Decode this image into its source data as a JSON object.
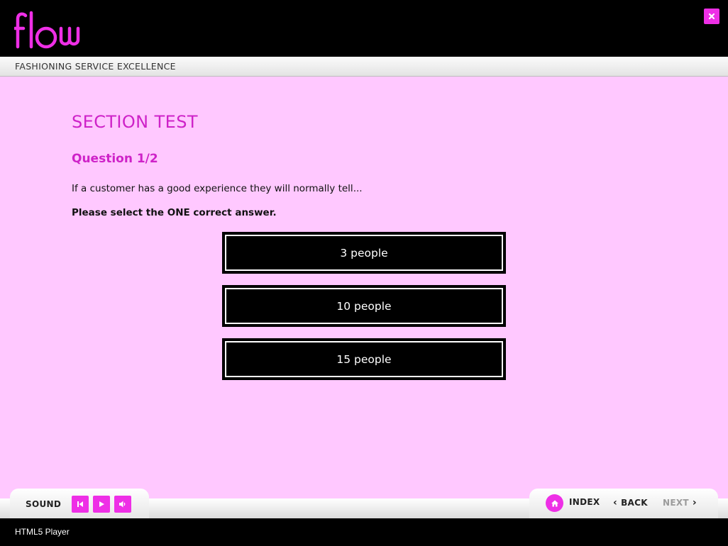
{
  "header": {
    "logo_text": "flow",
    "tagline": "FASHIONING SERVICE EXCELLENCE"
  },
  "main": {
    "section_title": "SECTION TEST",
    "question_number": "Question 1/2",
    "question_text": "If a customer has a good experience they will normally tell...",
    "instruction": "Please select the ONE correct answer.",
    "answers": [
      {
        "label": "3 people"
      },
      {
        "label": "10 people"
      },
      {
        "label": "15 people"
      }
    ]
  },
  "navbar": {
    "sound_label": "SOUND",
    "controls": [
      "rewind-icon",
      "play-icon",
      "speaker-icon"
    ],
    "index_label": "INDEX",
    "back_label": "BACK",
    "next_label": "NEXT"
  },
  "footer": {
    "text": "HTML5 Player"
  },
  "colors": {
    "accent": "#ee2fe6",
    "title": "#ce22c8",
    "background": "#ffc8ff",
    "chrome": "#000000"
  }
}
